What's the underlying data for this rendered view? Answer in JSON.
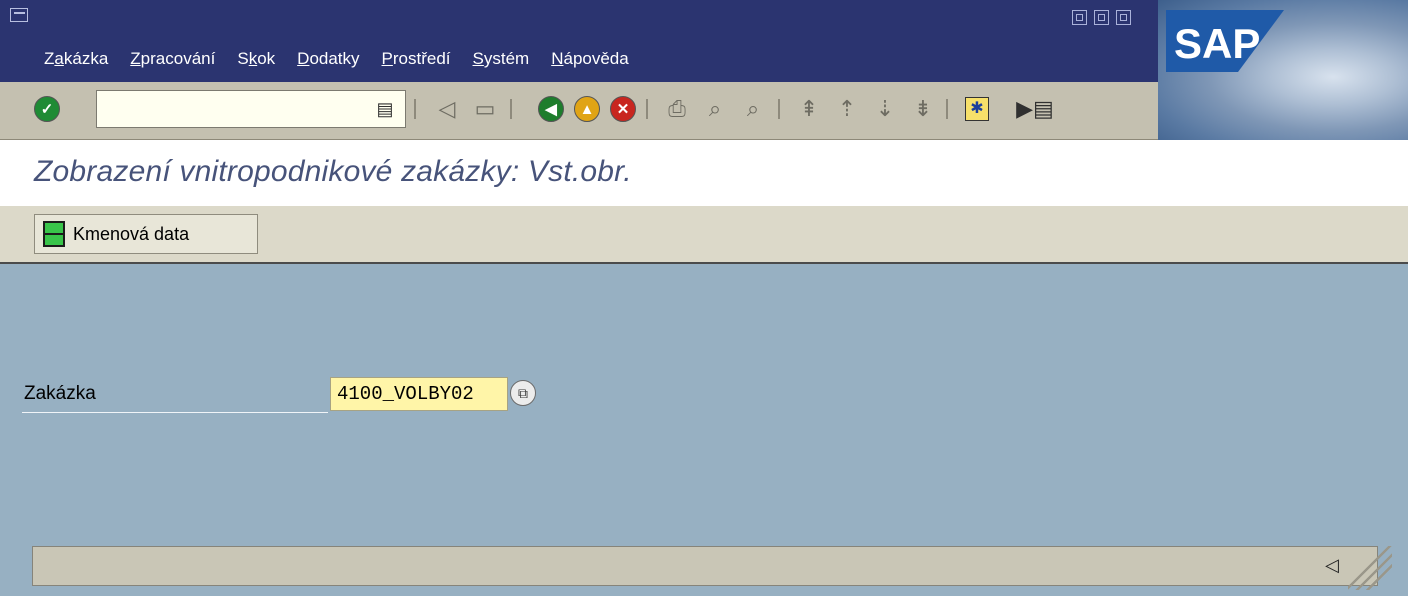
{
  "menu": {
    "items": [
      {
        "pre": "Z",
        "key": "a",
        "post": "kázka"
      },
      {
        "pre": "",
        "key": "Z",
        "post": "pracování"
      },
      {
        "pre": "S",
        "key": "k",
        "post": "ok"
      },
      {
        "pre": "",
        "key": "D",
        "post": "odatky"
      },
      {
        "pre": "",
        "key": "P",
        "post": "rostředí"
      },
      {
        "pre": "",
        "key": "S",
        "post": "ystém"
      },
      {
        "pre": "",
        "key": "N",
        "post": "ápověda"
      }
    ]
  },
  "brand": {
    "logo_text": "SAP",
    "brand_color": "#1f5aa8"
  },
  "toolbar": {
    "command_value": "",
    "icons": [
      "enter-icon",
      "back-icon",
      "save-icon",
      "green-back-icon",
      "exit-icon",
      "cancel-icon",
      "print-icon",
      "find-icon",
      "find-next-icon",
      "first-page-icon",
      "previous-page-icon",
      "next-page-icon",
      "last-page-icon",
      "new-session-icon",
      "layout-menu-icon"
    ]
  },
  "page": {
    "title": "Zobrazení vnitropodnikové zakázky: Vst.obr."
  },
  "app_toolbar": {
    "master_data_label": "Kmenová data"
  },
  "form": {
    "order_label": "Zakázka",
    "order_value": "4100_VOLBY02"
  },
  "status": {
    "text": ""
  },
  "colors": {
    "title_bar": "#2b3470",
    "toolbar": "#c4c0b0",
    "main_bg": "#97b0c2",
    "input_highlight": "#fff5a8",
    "title_text": "#47537a"
  }
}
